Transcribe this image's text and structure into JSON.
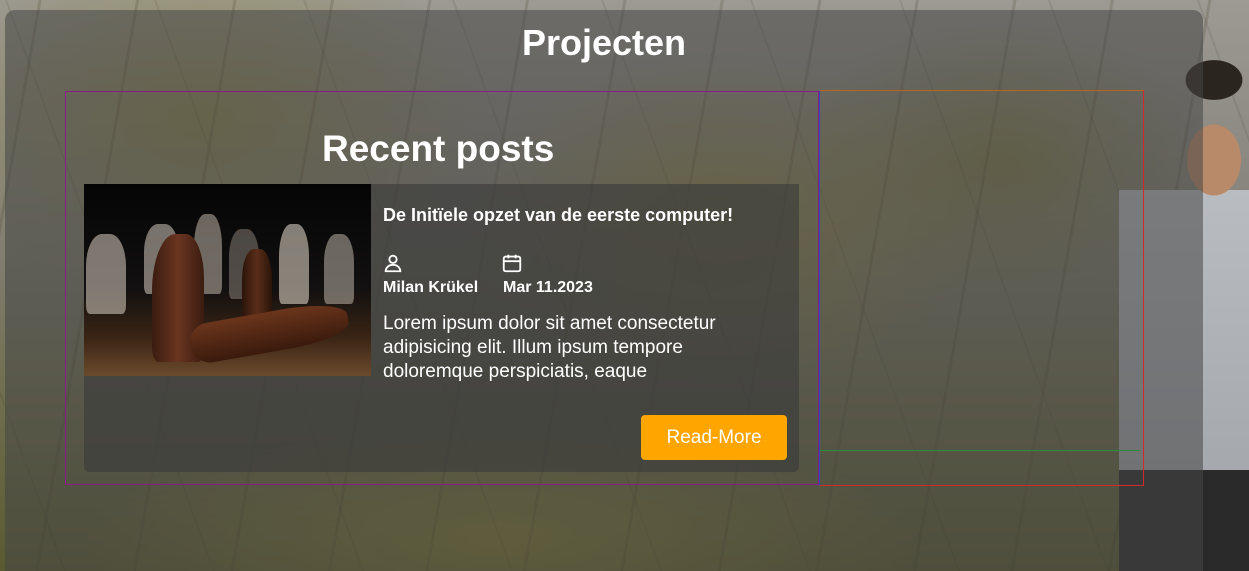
{
  "page": {
    "title": "Projecten"
  },
  "section": {
    "title": "Recent posts"
  },
  "post": {
    "title": "De Initïele opzet van de eerste computer!",
    "author": "Milan Krükel",
    "date": "Mar 11.2023",
    "excerpt": "Lorem ipsum dolor sit amet consectetur adipisicing elit. Illum ipsum tempore doloremque perspiciatis, eaque",
    "read_more_label": "Read-More",
    "image_icon": "chess-pieces-image",
    "author_icon": "user-icon",
    "date_icon": "calendar-icon"
  },
  "colors": {
    "accent": "#ffa500",
    "outline_left": "#8b1a8b",
    "outline_right": "#d22a2a"
  }
}
